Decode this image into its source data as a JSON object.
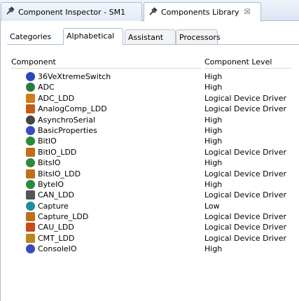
{
  "view_tabs": [
    {
      "label": "Component Inspector - SM1",
      "icon": "plug-icon",
      "active": false
    },
    {
      "label": "Components Library",
      "icon": "plug-icon",
      "active": true,
      "close": "☒"
    }
  ],
  "sub_tabs": [
    "Categories",
    "Alphabetical",
    "Assistant",
    "Processors"
  ],
  "active_sub_tab": "Alphabetical",
  "table": {
    "headers": [
      "Component",
      "Component Level"
    ],
    "rows": [
      {
        "name": "36VeXtremeSwitch",
        "level": "High",
        "icon": "x-circle-icon",
        "color": "#2a48b4"
      },
      {
        "name": "ADC",
        "level": "High",
        "icon": "globe-icon",
        "color": "#2e7a3c"
      },
      {
        "name": "ADC_LDD",
        "level": "Logical Device Driver",
        "icon": "adc-chip-icon",
        "color": "#d37b1a"
      },
      {
        "name": "AnalogComp_LDD",
        "level": "Logical Device Driver",
        "icon": "comparator-chip-icon",
        "color": "#c45d1a"
      },
      {
        "name": "AsynchroSerial",
        "level": "High",
        "icon": "serial-icon",
        "color": "#444444"
      },
      {
        "name": "BasicProperties",
        "level": "High",
        "icon": "bsp-icon",
        "color": "#3a49c2"
      },
      {
        "name": "BitIO",
        "level": "High",
        "icon": "bit-io-icon",
        "color": "#2e8a3c"
      },
      {
        "name": "BitIO_LDD",
        "level": "Logical Device Driver",
        "icon": "bit-io-chip-icon",
        "color": "#c26d1a"
      },
      {
        "name": "BitsIO",
        "level": "High",
        "icon": "bits-io-icon",
        "color": "#2e8a3c"
      },
      {
        "name": "BitsIO_LDD",
        "level": "Logical Device Driver",
        "icon": "bits-io-chip-icon",
        "color": "#c26d1a"
      },
      {
        "name": "ByteIO",
        "level": "High",
        "icon": "byte-io-icon",
        "color": "#2e8a3c"
      },
      {
        "name": "CAN_LDD",
        "level": "Logical Device Driver",
        "icon": "can-chip-icon",
        "color": "#555555"
      },
      {
        "name": "Capture",
        "level": "Low",
        "icon": "capture-icon",
        "color": "#1c8ea5"
      },
      {
        "name": "Capture_LDD",
        "level": "Logical Device Driver",
        "icon": "capture-chip-icon",
        "color": "#c26d1a"
      },
      {
        "name": "CAU_LDD",
        "level": "Logical Device Driver",
        "icon": "cau-chip-icon",
        "color": "#c94a1a"
      },
      {
        "name": "CMT_LDD",
        "level": "Logical Device Driver",
        "icon": "cmt-chip-icon",
        "color": "#b8861a"
      },
      {
        "name": "ConsoleIO",
        "level": "High",
        "icon": "console-io-icon",
        "color": "#3a49c2"
      }
    ]
  }
}
